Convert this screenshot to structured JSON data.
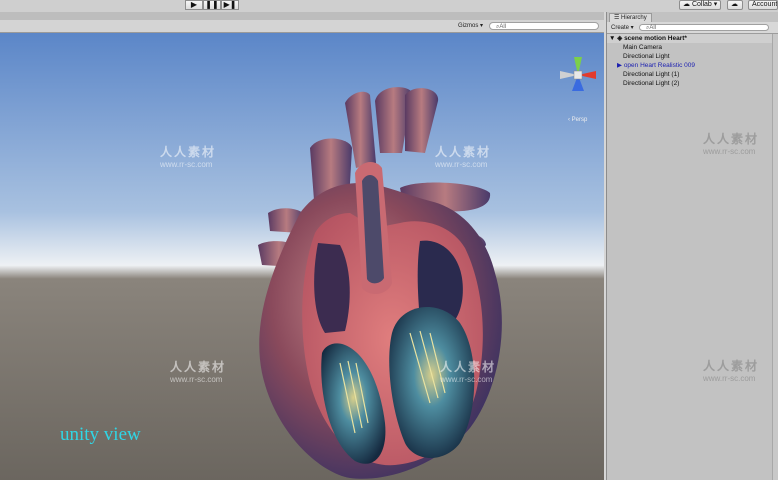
{
  "toolbar": {
    "play_icon": "play-icon",
    "pause_icon": "pause-icon",
    "step_icon": "step-icon",
    "collab_label": "Collab",
    "account_label": "Account"
  },
  "scene": {
    "gizmos_label": "Gizmos",
    "search_placeholder": "All",
    "persp_label": "Persp",
    "overlay_text": "unity view"
  },
  "hierarchy": {
    "tab_label": "Hierarchy",
    "create_label": "Create",
    "search_placeholder": "All",
    "scene_name": "scene motion Heart*",
    "items": [
      {
        "label": "Main Camera"
      },
      {
        "label": "Directional Light"
      },
      {
        "label": "open Heart Realistic 009"
      },
      {
        "label": "Directional Light (1)"
      },
      {
        "label": "Directional Light (2)"
      }
    ]
  },
  "watermark": {
    "brand": "人人素材",
    "url": "www.rr-sc.com"
  },
  "colors": {
    "overlay_text": "#2fd6e6",
    "prefab_text": "#1b1fb0",
    "sky_top": "#5b86c8",
    "ground": "#7a756e"
  }
}
